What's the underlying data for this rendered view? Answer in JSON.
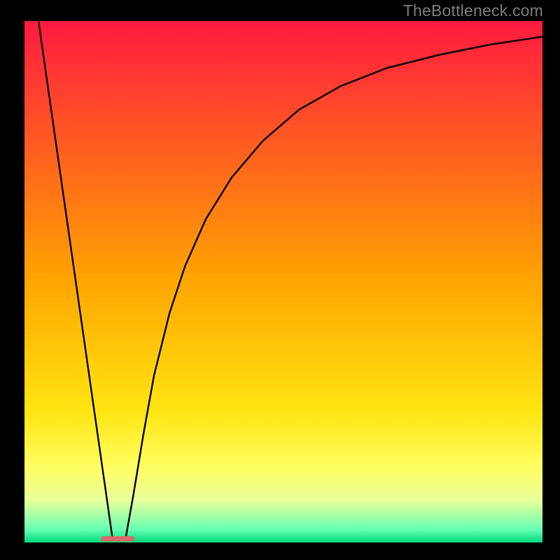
{
  "watermark": "TheBottleneck.com",
  "chart_data": {
    "type": "line",
    "title": "",
    "xlabel": "",
    "ylabel": "",
    "xlim": [
      0,
      100
    ],
    "ylim": [
      0,
      100
    ],
    "grid": false,
    "legend": false,
    "background": {
      "type": "vertical-gradient",
      "stops": [
        {
          "pct": 0,
          "color": "#ff1a40"
        },
        {
          "pct": 50,
          "color": "#ffa500"
        },
        {
          "pct": 75,
          "color": "#ffe612"
        },
        {
          "pct": 86,
          "color": "#ffff66"
        },
        {
          "pct": 92,
          "color": "#e8ff9c"
        },
        {
          "pct": 97.5,
          "color": "#66ffb3"
        },
        {
          "pct": 100,
          "color": "#00d97a"
        }
      ]
    },
    "marker": {
      "shape": "pill",
      "color": "#d86a6a",
      "x": 18,
      "y": 99.3,
      "w": 6.5,
      "h": 1
    },
    "series": [
      {
        "name": "left-line",
        "type": "line",
        "x": [
          2.7,
          17
        ],
        "y": [
          100,
          0.7
        ]
      },
      {
        "name": "right-curve",
        "type": "line",
        "x": [
          19.5,
          21,
          23,
          25,
          28,
          31,
          35,
          40,
          46,
          53,
          61,
          70,
          80,
          90,
          100
        ],
        "y": [
          0.7,
          9,
          21,
          32,
          44,
          53,
          62,
          70,
          77,
          83,
          87.5,
          91,
          93.5,
          95.5,
          97
        ]
      }
    ]
  }
}
